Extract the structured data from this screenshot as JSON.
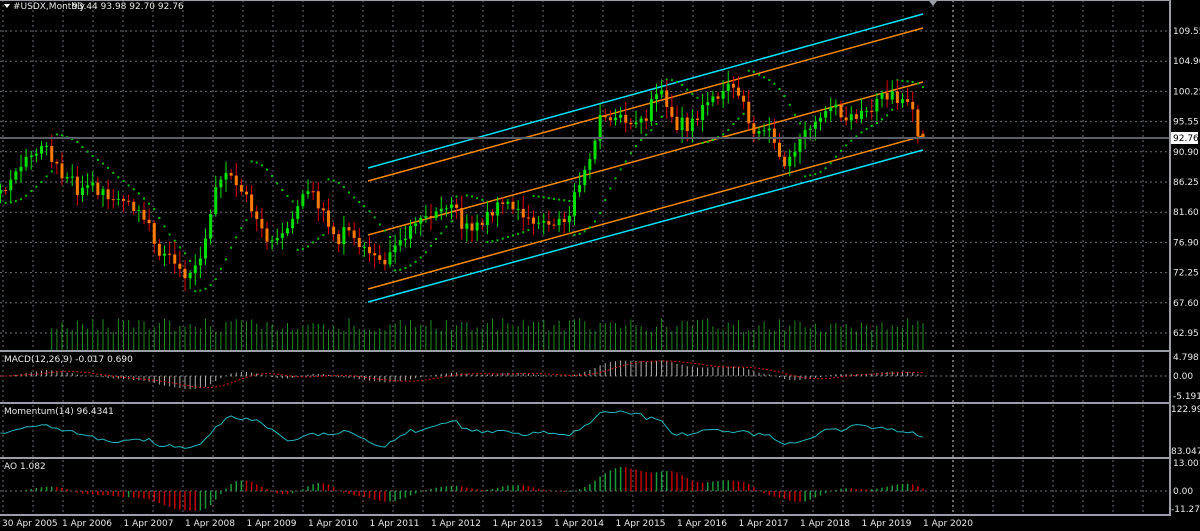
{
  "header": {
    "symbol": "#USDX,Monthly",
    "ohlc": "93.44 93.98 92.70 92.76"
  },
  "price_axis": [
    "109.55",
    "104.90",
    "100.25",
    "95.55",
    "90.90",
    "86.25",
    "81.60",
    "76.90",
    "72.25",
    "67.60",
    "62.95"
  ],
  "current_price": "92.76",
  "indicators": {
    "macd": {
      "label": "MACD(12,26,9) -0.017 0.690",
      "axis": [
        "4.798",
        "0.00",
        "-5.191"
      ]
    },
    "momentum": {
      "label": "Momentum(14) 96.4341",
      "axis": [
        "122.994",
        "83.047"
      ]
    },
    "ao": {
      "label": "AO 1.082",
      "axis": [
        "13.001",
        "0.00",
        "-11.271"
      ]
    }
  },
  "time_axis": [
    "30 Apr 2005",
    "1 Apr 2006",
    "1 Apr 2007",
    "1 Apr 2008",
    "1 Apr 2009",
    "1 Apr 2010",
    "1 Apr 2011",
    "1 Apr 2012",
    "1 Apr 2013",
    "1 Apr 2014",
    "1 Apr 2015",
    "1 Apr 2016",
    "1 Apr 2017",
    "1 Apr 2018",
    "1 Apr 2019",
    "1 Apr 2020"
  ],
  "colors": {
    "bull": "#00e000",
    "bear": "#ff7a00",
    "wick_bear": "#e00000",
    "channel_outer": "#00e5ff",
    "channel_inner": "#ff8c00",
    "sar": "#00c000",
    "volume": "#1f8a1f",
    "momentum": "#20b8c0",
    "macd_signal": "#d01010",
    "macd_hist": "#b0b0b0"
  },
  "chart_data": {
    "type": "candlestick",
    "title": "#USDX,Monthly",
    "period": "Monthly, Apr 2005 - Apr 2020",
    "quarterly_close_anchors": [
      84,
      89,
      91.5,
      90,
      86,
      85,
      86,
      84.5,
      82,
      80.5,
      77,
      75,
      72.5,
      73,
      85,
      88,
      85,
      79,
      76,
      80,
      86,
      82,
      78,
      77,
      74,
      74,
      78,
      80,
      79,
      82,
      80,
      80,
      82.5,
      82,
      80,
      81,
      80,
      82,
      86.5,
      95,
      97,
      96,
      97,
      98.5,
      94,
      96,
      99,
      101,
      99,
      93,
      94.5,
      90,
      92,
      94.5,
      96.5,
      96,
      97.5,
      98,
      98.5,
      97.5,
      92.76
    ],
    "last_bar": {
      "open": 93.44,
      "high": 93.98,
      "low": 92.7,
      "close": 92.76
    },
    "ylim": [
      62.95,
      112
    ],
    "channel": "equidistant regression channel, Apr 2011 - Apr 2020"
  }
}
